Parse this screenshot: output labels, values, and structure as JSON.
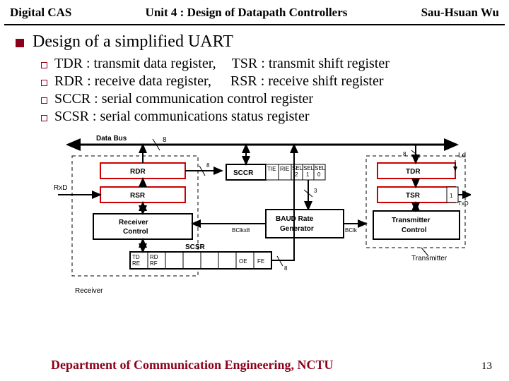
{
  "header": {
    "left": "Digital CAS",
    "center": "Unit 4 : Design of Datapath Controllers",
    "right": "Sau-Hsuan Wu"
  },
  "title": "Design of a simplified UART",
  "bullets": [
    {
      "a": "TDR : transmit data register,",
      "b": "TSR : transmit shift register"
    },
    {
      "a": "RDR : receive data register,",
      "b": "RSR : receive shift register"
    },
    {
      "a": "SCCR : serial communication control register",
      "b": ""
    },
    {
      "a": "SCSR : serial communications status register",
      "b": ""
    }
  ],
  "diagram": {
    "top_bus": "Data Bus",
    "bus_width": "8",
    "receiver": {
      "label": "Receiver",
      "rdr": "RDR",
      "rsr": "RSR",
      "ctrl": "Receiver Control",
      "rxd": "RxD",
      "rdr_out_width": "8"
    },
    "center": {
      "sccr": "SCCR",
      "sccr_bits": [
        "TIE",
        "RIE",
        "SEL 2",
        "SEL 1",
        "SEL 0"
      ],
      "sccr_sel_width": "3",
      "baud": "BAUD Rate Generator",
      "bclkx8": "BClkx8",
      "bclk": "BClk"
    },
    "scsr": {
      "label": "SCSR",
      "bits": [
        "TD RE",
        "RD RF",
        "",
        "",
        "",
        "",
        "OE",
        "FE"
      ],
      "out_width": "8"
    },
    "transmitter": {
      "label": "Transmitter",
      "tdr": "TDR",
      "tsr": "TSR",
      "ctrl": "Transmitter Control",
      "ld": "Ld",
      "tdr_in_width": "8",
      "txd": "TxD",
      "txd_width": "1"
    }
  },
  "footer": {
    "dept": "Department of Communication Engineering, NCTU",
    "page": "13"
  }
}
